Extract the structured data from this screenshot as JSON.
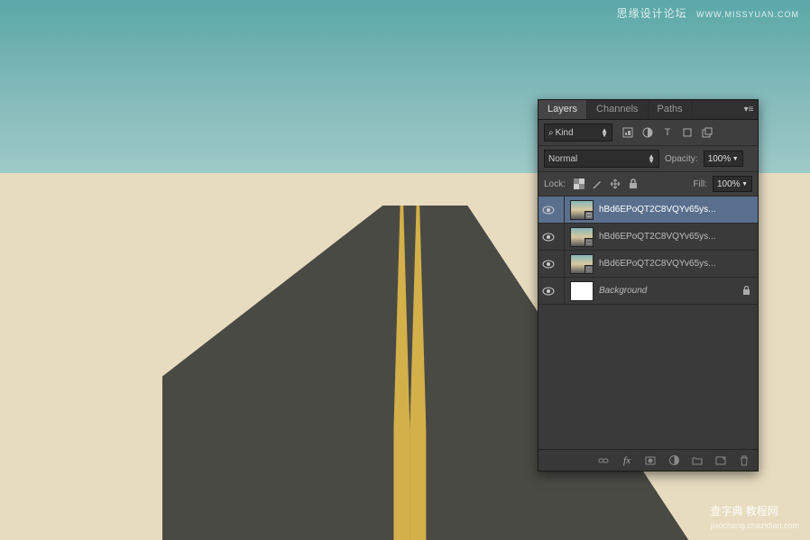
{
  "watermarks": {
    "top_left": "思缘设计论坛",
    "top_right": "WWW.MISSYUAN.COM",
    "bottom_right_main": "查字典 教程网",
    "bottom_right_sub": "jiaocheng.chazidian.com"
  },
  "panel": {
    "tabs": [
      "Layers",
      "Channels",
      "Paths"
    ],
    "active_tab": 0,
    "filter_kind": "Kind",
    "blend_mode": "Normal",
    "opacity_label": "Opacity:",
    "opacity_value": "100%",
    "lock_label": "Lock:",
    "fill_label": "Fill:",
    "fill_value": "100%",
    "layers": [
      {
        "name": "hBd6EPoQT2C8VQYv65ys...",
        "visible": true,
        "smart": true,
        "locked": false,
        "active": true
      },
      {
        "name": "hBd6EPoQT2C8VQYv65ys...",
        "visible": true,
        "smart": true,
        "locked": false,
        "active": false
      },
      {
        "name": "hBd6EPoQT2C8VQYv65ys...",
        "visible": true,
        "smart": true,
        "locked": false,
        "active": false
      },
      {
        "name": "Background",
        "visible": true,
        "smart": false,
        "locked": true,
        "active": false,
        "bg": true
      }
    ]
  }
}
